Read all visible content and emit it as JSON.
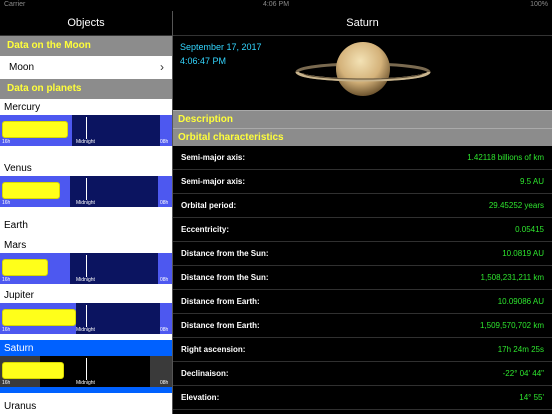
{
  "status": {
    "carrier": "Carrier",
    "time": "4:06 PM",
    "battery": "100%"
  },
  "left": {
    "title": "Objects",
    "moon_section": "Data on the Moon",
    "moon_item": "Moon",
    "planets_section": "Data on planets",
    "planets": [
      {
        "name": "Mercury",
        "label_left": "16h",
        "label_mid": "Midnight",
        "label_right": "08h"
      },
      {
        "name": "Venus",
        "label_left": "16h",
        "label_mid": "Midnight",
        "label_right": "08h"
      },
      {
        "name": "Earth"
      },
      {
        "name": "Mars",
        "label_left": "16h",
        "label_mid": "Midnight",
        "label_right": "08h"
      },
      {
        "name": "Jupiter",
        "label_left": "16h",
        "label_mid": "Midnight",
        "label_right": "08h"
      },
      {
        "name": "Saturn",
        "label_left": "16h",
        "label_mid": "Midnight",
        "label_right": "08h"
      },
      {
        "name": "Uranus"
      }
    ]
  },
  "right": {
    "title": "Saturn",
    "date": "September 17, 2017",
    "time": "4:06:47 PM",
    "description_section": "Description",
    "orbital_section": "Orbital characteristics",
    "rows": [
      {
        "label": "Semi-major axis:",
        "value": "1.42118 billions of  km"
      },
      {
        "label": "Semi-major axis:",
        "value": "9.5 AU"
      },
      {
        "label": "Orbital period:",
        "value": "29.45252 years"
      },
      {
        "label": "Eccentricity:",
        "value": "0.05415"
      },
      {
        "label": "Distance from the Sun:",
        "value": "10.0819 AU"
      },
      {
        "label": "Distance from the Sun:",
        "value": "1,508,231,211 km"
      },
      {
        "label": "Distance from Earth:",
        "value": "10.09086 AU"
      },
      {
        "label": "Distance from Earth:",
        "value": "1,509,570,702 km"
      },
      {
        "label": "Right ascension:",
        "value": "17h 24m 25s"
      },
      {
        "label": "Declinaison:",
        "value": "-22° 04' 44\""
      },
      {
        "label": "Elevation:",
        "value": "14° 55'"
      }
    ]
  },
  "colors": {
    "accent": "#0061ff",
    "section_text": "#ffff3a",
    "value_green": "#2ee62e",
    "cyan": "#33d6ff"
  }
}
